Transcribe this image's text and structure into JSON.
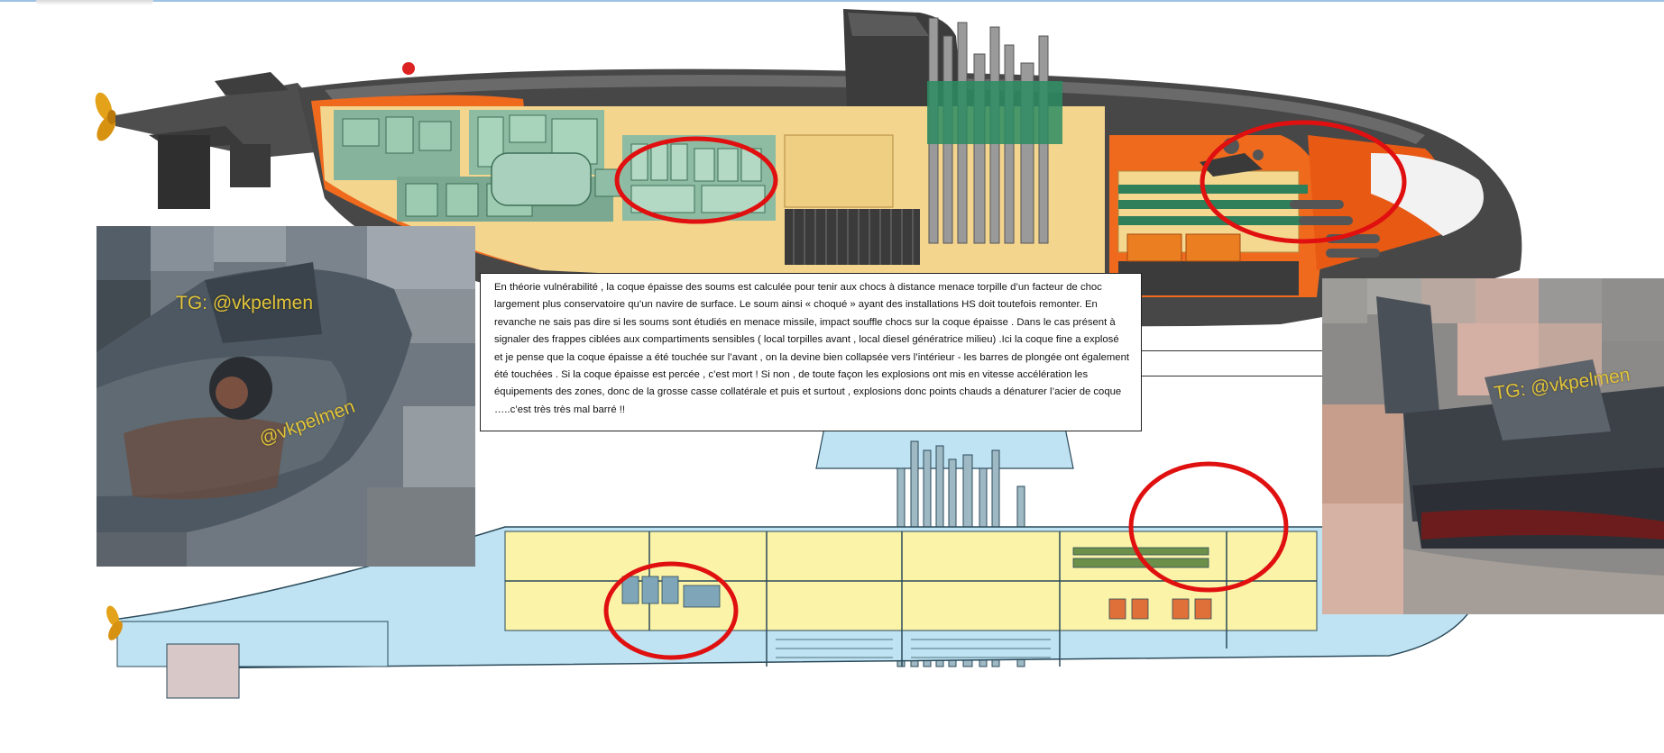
{
  "annotation_text": "En théorie vulnérabilité , la coque épaisse des  soums est calculée pour tenir aux chocs à distance menace torpille d’un facteur de choc largement plus conservatoire qu’un navire de surface. Le soum ainsi « choqué » ayant des installations HS  doit toutefois remonter.  En revanche ne sais pas dire si les soums sont étudiés en menace missile, impact souffle chocs sur la coque épaisse . Dans le cas présent à signaler des frappes ciblées aux compartiments sensibles ( local torpilles avant ,  local diesel génératrice milieu) .Ici  la coque fine  a explosé  et je pense que  la coque épaisse a été touchée  sur l’avant , on la devine bien collapsée vers l’intérieur -  les barres de plongée ont également été touchées . Si la coque épaisse est percée , c’est mort ! Si non , de toute façon les explosions ont mis en vitesse accélération les équipements des zones, donc de la grosse casse collatérale et puis et surtout , explosions donc points chauds a dénaturer l’acier de coque …..c’est très très mal barré !!",
  "photo_left": {
    "watermark_top": "TG: @vkpelmen",
    "watermark_mid": "@vkpelmen"
  },
  "photo_right": {
    "watermark": "TG: @vkpelmen"
  },
  "colors": {
    "hull_dark": "#4a4a4a",
    "hull_orange": "#f06a1e",
    "interior_cream": "#f4d890",
    "machinery_green": "#7fae98",
    "blueprint_blue": "#bfe3f2",
    "blueprint_yellow": "#fbf3a8",
    "highlight_red": "#e01010",
    "watermark_yellow": "#e2c43a"
  }
}
